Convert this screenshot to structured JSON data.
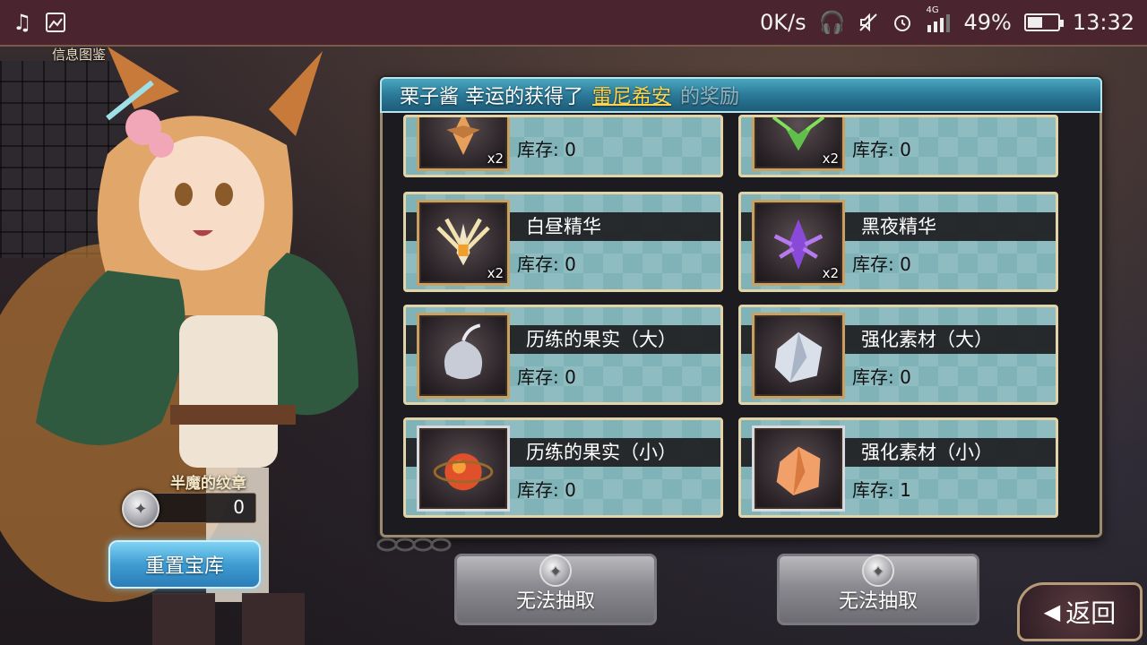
{
  "status_bar": {
    "left_icons": [
      "music-note-icon",
      "image-icon"
    ],
    "net_speed": "0K/s",
    "network_label": "4G",
    "battery_percent": "49%",
    "battery_level": 0.49,
    "time": "13:32"
  },
  "top_label": "信息图鉴",
  "panel": {
    "header_prefix": "栗子酱 幸运的获得了",
    "header_highlight": "雷尼希安",
    "header_suffix": "的奖励",
    "items": [
      {
        "name": "",
        "stock_label": "库存: 0",
        "qty": "x2",
        "icon": "amber-crystal-icon",
        "frame": "gold"
      },
      {
        "name": "",
        "stock_label": "库存: 0",
        "qty": "x2",
        "icon": "green-dragon-icon",
        "frame": "gold"
      },
      {
        "name": "白昼精华",
        "stock_label": "库存: 0",
        "qty": "x2",
        "icon": "daylight-essence-icon",
        "frame": "gold"
      },
      {
        "name": "黑夜精华",
        "stock_label": "库存: 0",
        "qty": "x2",
        "icon": "night-essence-icon",
        "frame": "gold"
      },
      {
        "name": "历练的果实（大）",
        "stock_label": "库存: 0",
        "qty": "",
        "icon": "silver-fruit-icon",
        "frame": "gold"
      },
      {
        "name": "强化素材（大）",
        "stock_label": "库存: 0",
        "qty": "",
        "icon": "silver-ore-icon",
        "frame": "gold"
      },
      {
        "name": "历练的果实（小）",
        "stock_label": "库存: 0",
        "qty": "",
        "icon": "ember-fruit-icon",
        "frame": "silver"
      },
      {
        "name": "强化素材（小）",
        "stock_label": "库存: 1",
        "qty": "",
        "icon": "copper-ore-icon",
        "frame": "silver"
      }
    ]
  },
  "currency": {
    "title": "半魔的纹章",
    "value": "0",
    "icon": "emblem-coin-icon"
  },
  "buttons": {
    "reset": "重置宝库",
    "extract_left": "无法抽取",
    "extract_right": "无法抽取",
    "back": "返回"
  },
  "colors": {
    "status_bar": "#4a2530",
    "header_highlight": "#ffd34a",
    "reset_button": "#3f9cd2",
    "card_bg": "#7fb3b8",
    "card_border": "#e3d3a8"
  }
}
